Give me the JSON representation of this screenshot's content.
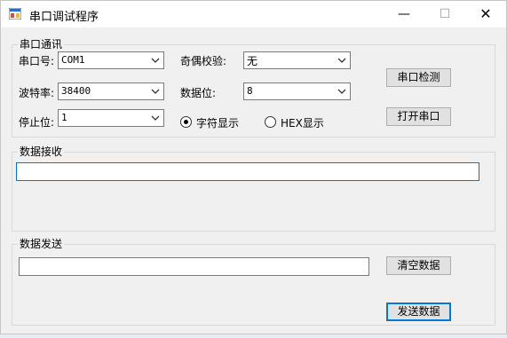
{
  "window": {
    "title": "串口调试程序",
    "controls": {
      "minimize": "—",
      "maximize": "☐",
      "close": "✕"
    }
  },
  "serial_group": {
    "label": "串口通讯",
    "port_label": "串口号:",
    "port_value": "COM1",
    "baud_label": "波特率:",
    "baud_value": "38400",
    "stop_label": "停止位:",
    "stop_value": "1",
    "parity_label": "奇偶校验:",
    "parity_value": "无",
    "databits_label": "数据位:",
    "databits_value": "8",
    "radio_char_label": "字符显示",
    "radio_hex_label": "HEX显示",
    "radio_selected": "char",
    "detect_button": "串口检测",
    "open_button": "打开串口"
  },
  "receive_group": {
    "label": "数据接收",
    "text": ""
  },
  "send_group": {
    "label": "数据发送",
    "input_value": "",
    "clear_button": "清空数据",
    "send_button": "发送数据"
  },
  "colors": {
    "window_bg": "#f0f0f0",
    "focus_blue": "#0078d7",
    "button_bg": "#e1e1e1"
  }
}
